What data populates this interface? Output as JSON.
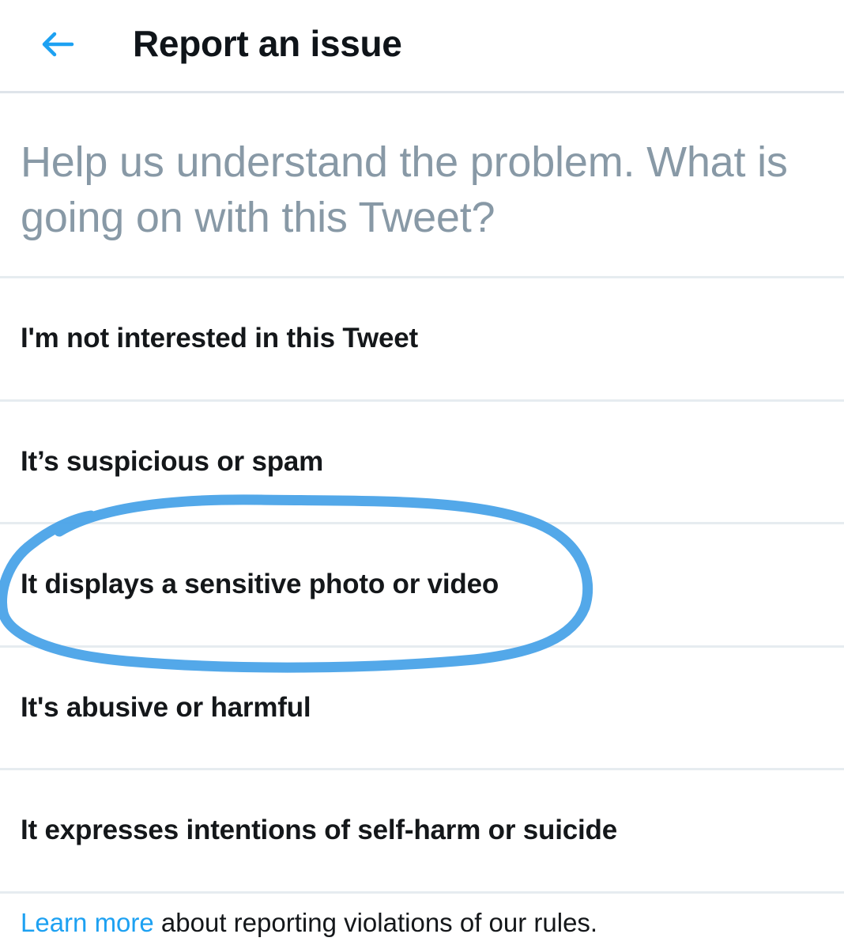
{
  "header": {
    "back_icon": "arrow-left-icon",
    "title": "Report an issue",
    "accent_color": "#1da1f2"
  },
  "prompt": {
    "text": "Help us understand the problem. What is going on with this Tweet?"
  },
  "options": [
    {
      "label": "I'm not interested in this Tweet"
    },
    {
      "label": "It’s suspicious or spam"
    },
    {
      "label": "It displays a sensitive photo or video"
    },
    {
      "label": "It's abusive or harmful"
    },
    {
      "label": "It expresses intentions of self-harm or suicide"
    }
  ],
  "footer": {
    "link_text": "Learn more",
    "rest_text": " about reporting violations of our rules."
  },
  "annotation": {
    "circled_option": "It displays a sensitive photo or video",
    "color": "#4aa3e8"
  }
}
